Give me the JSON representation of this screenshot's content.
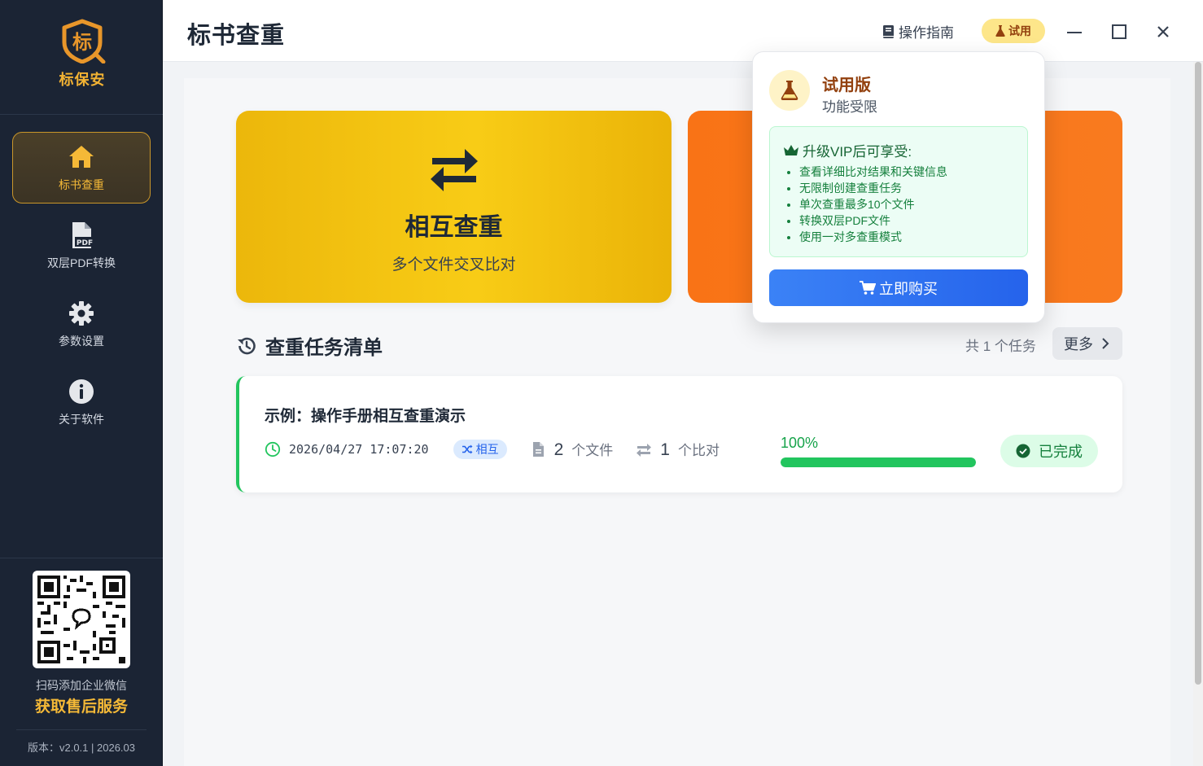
{
  "brand": {
    "logo_glyph": "标",
    "name": "标保安",
    "accent": "#f5b937"
  },
  "sidebar": {
    "items": [
      {
        "label": "标书查重",
        "icon": "home-icon",
        "active": true
      },
      {
        "label": "双层PDF转换",
        "icon": "pdf-file-icon",
        "active": false
      },
      {
        "label": "参数设置",
        "icon": "gear-icon",
        "active": false
      },
      {
        "label": "关于软件",
        "icon": "info-icon",
        "active": false
      }
    ],
    "qr_caption": "扫码添加企业微信",
    "qr_service": "获取售后服务",
    "version": "版本：v2.0.1 | 2026.03"
  },
  "header": {
    "title": "标书查重",
    "guide_label": "操作指南",
    "trial_label": "试用"
  },
  "cards": {
    "mutual": {
      "title": "相互查重",
      "subtitle": "多个文件交叉比对",
      "color": "#f8cc16"
    },
    "second": {
      "color": "#f97316"
    }
  },
  "tasks": {
    "section_title": "查重任务清单",
    "count_text": "共 1 个任务",
    "more_label": "更多",
    "items": [
      {
        "name": "示例：操作手册相互查重演示",
        "time": "2026/04/27 17:07:20",
        "mode": "相互",
        "files_num": "2",
        "files_unit": "个文件",
        "pairs_num": "1",
        "pairs_unit": "个比对",
        "progress_text": "100%",
        "progress": 1.0,
        "status": "已完成"
      }
    ]
  },
  "popover": {
    "title": "试用版",
    "subtitle": "功能受限",
    "vip_heading": "升级VIP后可享受:",
    "benefits": [
      "查看详细比对结果和关键信息",
      "无限制创建查重任务",
      "单次查重最多10个文件",
      "转换双层PDF文件",
      "使用一对多查重模式"
    ],
    "buy_label": "立即购买"
  }
}
